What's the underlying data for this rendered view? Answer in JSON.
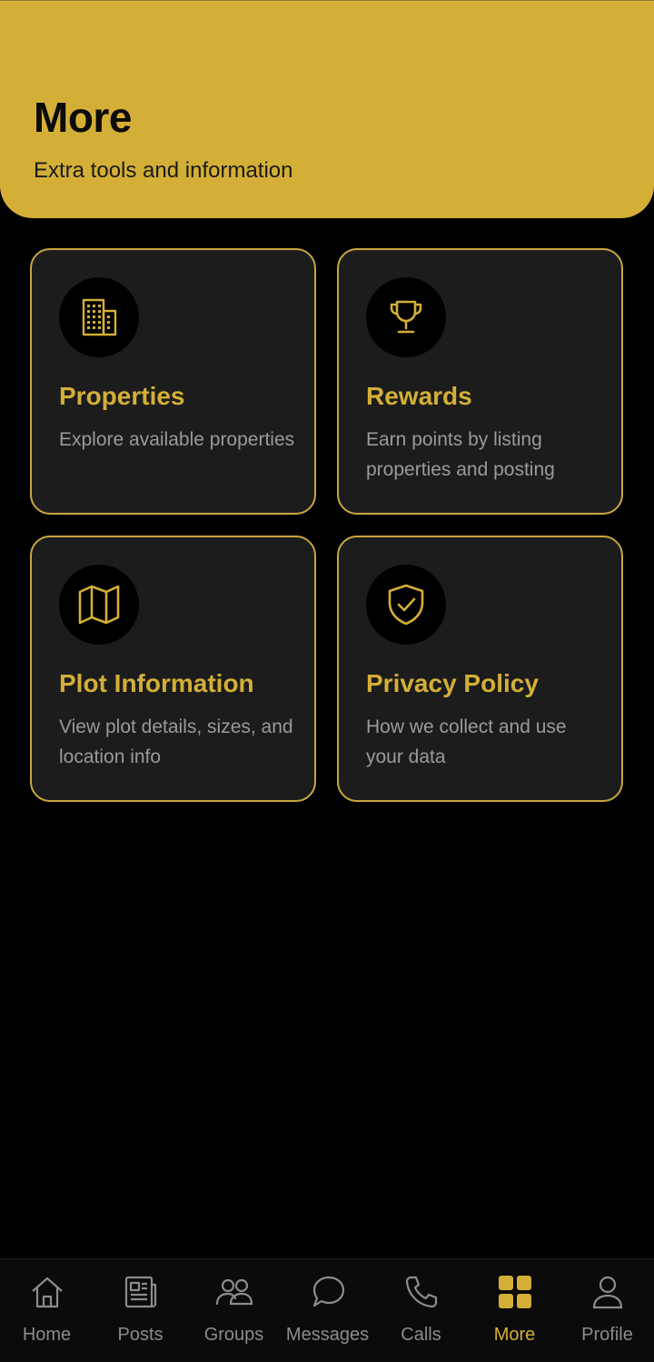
{
  "header": {
    "title": "More",
    "subtitle": "Extra tools and information"
  },
  "cards": [
    {
      "title": "Properties",
      "description": "Explore available properties",
      "icon": "building-icon"
    },
    {
      "title": "Rewards",
      "description": "Earn points by listing properties and posting",
      "icon": "trophy-icon"
    },
    {
      "title": "Plot Information",
      "description": "View plot details, sizes, and location info",
      "icon": "map-icon"
    },
    {
      "title": "Privacy Policy",
      "description": "How we collect and use your data",
      "icon": "shield-check-icon"
    }
  ],
  "nav": {
    "items": [
      {
        "label": "Home",
        "icon": "home-icon",
        "active": false
      },
      {
        "label": "Posts",
        "icon": "newspaper-icon",
        "active": false
      },
      {
        "label": "Groups",
        "icon": "users-icon",
        "active": false
      },
      {
        "label": "Messages",
        "icon": "chat-bubble-icon",
        "active": false
      },
      {
        "label": "Calls",
        "icon": "phone-icon",
        "active": false
      },
      {
        "label": "More",
        "icon": "grid-icon",
        "active": true
      },
      {
        "label": "Profile",
        "icon": "user-icon",
        "active": false
      }
    ]
  },
  "colors": {
    "accent": "#D4AF37",
    "background": "#000000",
    "card": "#1c1c1c",
    "muted_text": "#9a9a9a",
    "inactive_nav": "#8c8c8c"
  }
}
